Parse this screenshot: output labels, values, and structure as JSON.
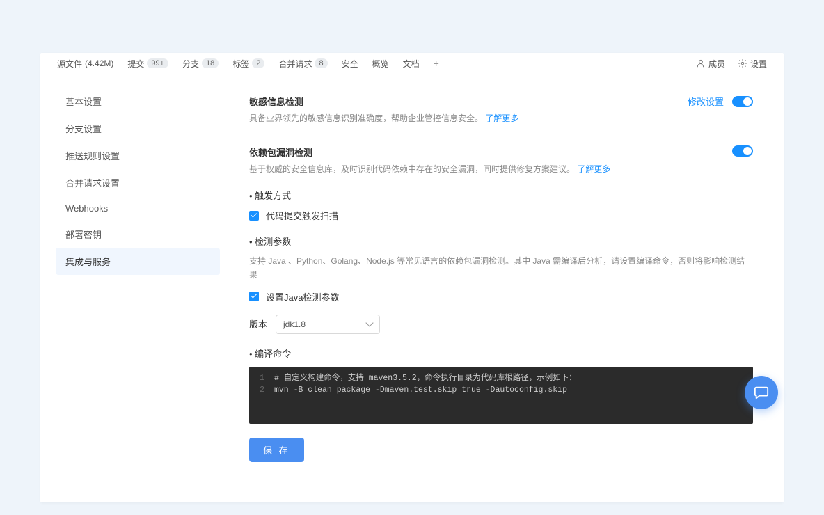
{
  "nav": {
    "source_files": {
      "label": "源文件",
      "size": "(4.42M)"
    },
    "commits": {
      "label": "提交",
      "count": "99+"
    },
    "branches": {
      "label": "分支",
      "count": "18"
    },
    "tags": {
      "label": "标签",
      "count": "2"
    },
    "merge_requests": {
      "label": "合并请求",
      "count": "8"
    },
    "security": "安全",
    "overview": "概览",
    "docs": "文档",
    "members": "成员",
    "settings": "设置"
  },
  "sidebar": {
    "items": [
      {
        "label": "基本设置"
      },
      {
        "label": "分支设置"
      },
      {
        "label": "推送规则设置"
      },
      {
        "label": "合并请求设置"
      },
      {
        "label": "Webhooks"
      },
      {
        "label": "部署密钥"
      },
      {
        "label": "集成与服务"
      }
    ]
  },
  "sections": {
    "sensitive": {
      "title": "敏感信息检测",
      "desc": "具备业界领先的敏感信息识别准确度，帮助企业管控信息安全。 ",
      "learn_more": "了解更多",
      "modify": "修改设置"
    },
    "dependency": {
      "title": "依赖包漏洞检测",
      "desc": "基于权威的安全信息库，及时识别代码依赖中存在的安全漏洞，同时提供修复方案建议。 ",
      "learn_more": "了解更多"
    }
  },
  "trigger": {
    "heading": "• 触发方式",
    "checkbox_label": "代码提交触发扫描"
  },
  "params": {
    "heading": "• 检测参数",
    "desc": "支持 Java 、Python、Golang、Node.js 等常见语言的依赖包漏洞检测。其中 Java 需编译后分析，请设置编译命令，否则将影响检测结果",
    "java_check": "设置Java检测参数"
  },
  "version": {
    "label": "版本",
    "selected": "jdk1.8"
  },
  "compile": {
    "heading": "• 编译命令",
    "lines": [
      "# 自定义构建命令，支持 maven3.5.2，命令执行目录为代码库根路径，示例如下：",
      "mvn -B clean package -Dmaven.test.skip=true -Dautoconfig.skip"
    ]
  },
  "save_button": "保 存"
}
